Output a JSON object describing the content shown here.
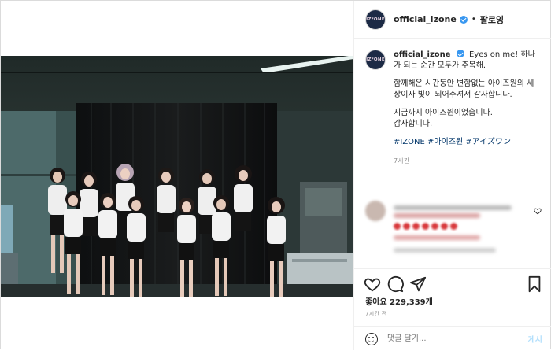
{
  "header": {
    "avatar_text": "IZ*ONE",
    "username": "official_izone",
    "separator": "•",
    "follow_label": "팔로잉"
  },
  "caption": {
    "username": "official_izone",
    "line1": "Eyes on me! 하나가 되는 순간 모두가 주목해.",
    "line2": "함께해온 시간동안 변함없는 아이즈원의 세상이자 빛이 되어주셔서 감사합니다.",
    "line3": "지금까지 아이즈원이었습니다.",
    "line4": "감사합니다.",
    "hashtags": [
      "#IZONE",
      "#아이즈원",
      "#アイズワン"
    ],
    "time": "7시간"
  },
  "actions": {
    "icons": [
      "heart-icon",
      "comment-icon",
      "share-icon",
      "bookmark-icon"
    ],
    "likes_label": "좋아요",
    "likes_count": "229,339개",
    "posted_ago": "7시간 전"
  },
  "comment_box": {
    "placeholder": "댓글 달기...",
    "post_label": "게시"
  },
  "colors": {
    "verified": "#3897f0",
    "hashtag": "#003569",
    "post_button": "#b2dffc",
    "photo_background": "#2a3532"
  }
}
